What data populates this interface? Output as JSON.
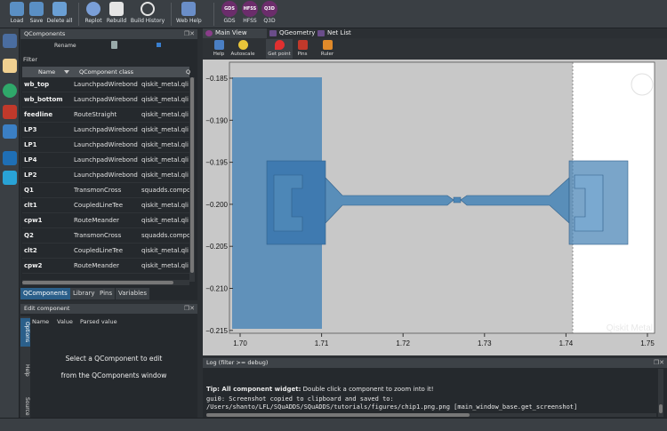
{
  "toolbar": {
    "buttons": [
      {
        "label": "Load",
        "icon": "load-icon"
      },
      {
        "label": "Save",
        "icon": "save-icon"
      },
      {
        "label": "Delete all",
        "icon": "delete-all-icon"
      },
      {
        "label": "Replot",
        "icon": "replot-icon"
      },
      {
        "label": "Rebuild",
        "icon": "rebuild-icon"
      },
      {
        "label": "Build History",
        "icon": "history-icon"
      },
      {
        "label": "Web Help",
        "icon": "web-help-icon"
      },
      {
        "label": "GDS",
        "icon": "gds-icon"
      },
      {
        "label": "HFSS",
        "icon": "hfss-icon"
      },
      {
        "label": "Q3D",
        "icon": "q3d-icon"
      }
    ]
  },
  "qcomponents": {
    "title": "QComponents",
    "rename_label": "Rename",
    "filter_label": "Filter",
    "columns": [
      "Name",
      "QComponent class",
      "Q"
    ],
    "rows": [
      [
        "wb_top",
        "LaunchpadWirebond",
        "qiskit_metal.qli"
      ],
      [
        "wb_bottom",
        "LaunchpadWirebond",
        "qiskit_metal.qli"
      ],
      [
        "feedline",
        "RouteStraight",
        "qiskit_metal.qli"
      ],
      [
        "LP3",
        "LaunchpadWirebond",
        "qiskit_metal.qli"
      ],
      [
        "LP1",
        "LaunchpadWirebond",
        "qiskit_metal.qli"
      ],
      [
        "LP4",
        "LaunchpadWirebond",
        "qiskit_metal.qli"
      ],
      [
        "LP2",
        "LaunchpadWirebond",
        "qiskit_metal.qli"
      ],
      [
        "Q1",
        "TransmonCross",
        "squadds.compo"
      ],
      [
        "clt1",
        "CoupledLineTee",
        "qiskit_metal.qli"
      ],
      [
        "cpw1",
        "RouteMeander",
        "qiskit_metal.qli"
      ],
      [
        "Q2",
        "TransmonCross",
        "squadds.compo"
      ],
      [
        "clt2",
        "CoupledLineTee",
        "qiskit_metal.qli"
      ],
      [
        "cpw2",
        "RouteMeander",
        "qiskit_metal.qli"
      ]
    ],
    "tabs": [
      "QComponents",
      "Library",
      "Pins",
      "Variables"
    ]
  },
  "edit_component": {
    "title": "Edit component",
    "columns": [
      "Name",
      "Value",
      "Parsed value"
    ],
    "side_tabs": [
      "Options",
      "Help",
      "Source"
    ],
    "message_line1": "Select a QComponent to edit",
    "message_line2": "from the QComponents window"
  },
  "main_tabs": [
    "Main View",
    "QGeometry",
    "Net List"
  ],
  "view_toolbar": [
    {
      "label": "Help",
      "icon": "help-icon"
    },
    {
      "label": "Autoscale",
      "icon": "autoscale-icon"
    },
    {
      "label": "Get point",
      "icon": "get-point-icon"
    },
    {
      "label": "Pins",
      "icon": "pins-icon"
    },
    {
      "label": "Ruler",
      "icon": "ruler-icon"
    }
  ],
  "plot": {
    "watermark": "Qiskit Metal",
    "x_ticks": [
      "1.70",
      "1.71",
      "1.72",
      "1.73",
      "1.74",
      "1.75"
    ],
    "y_ticks": [
      "−0.185",
      "−0.190",
      "−0.195",
      "−0.200",
      "−0.205",
      "−0.210",
      "−0.215"
    ],
    "colors": {
      "background": "#c8c8c8",
      "white_region": "#ffffff",
      "metal": "#4d87b7",
      "metal_light": "#7aa9d0"
    }
  },
  "log": {
    "title": "Log  (filter >= debug)",
    "tip_bold": "Tip: All component widget:",
    "tip_text": " Double click a component to zoom into it!",
    "line2": "gui0: Screenshot copied to clipboard and saved to:",
    "line3": "/Users/shanto/LFL/SQuADDS/SQuADDS/tutorials/figures/chip1.png.png [main_window_base.get_screenshot]"
  }
}
